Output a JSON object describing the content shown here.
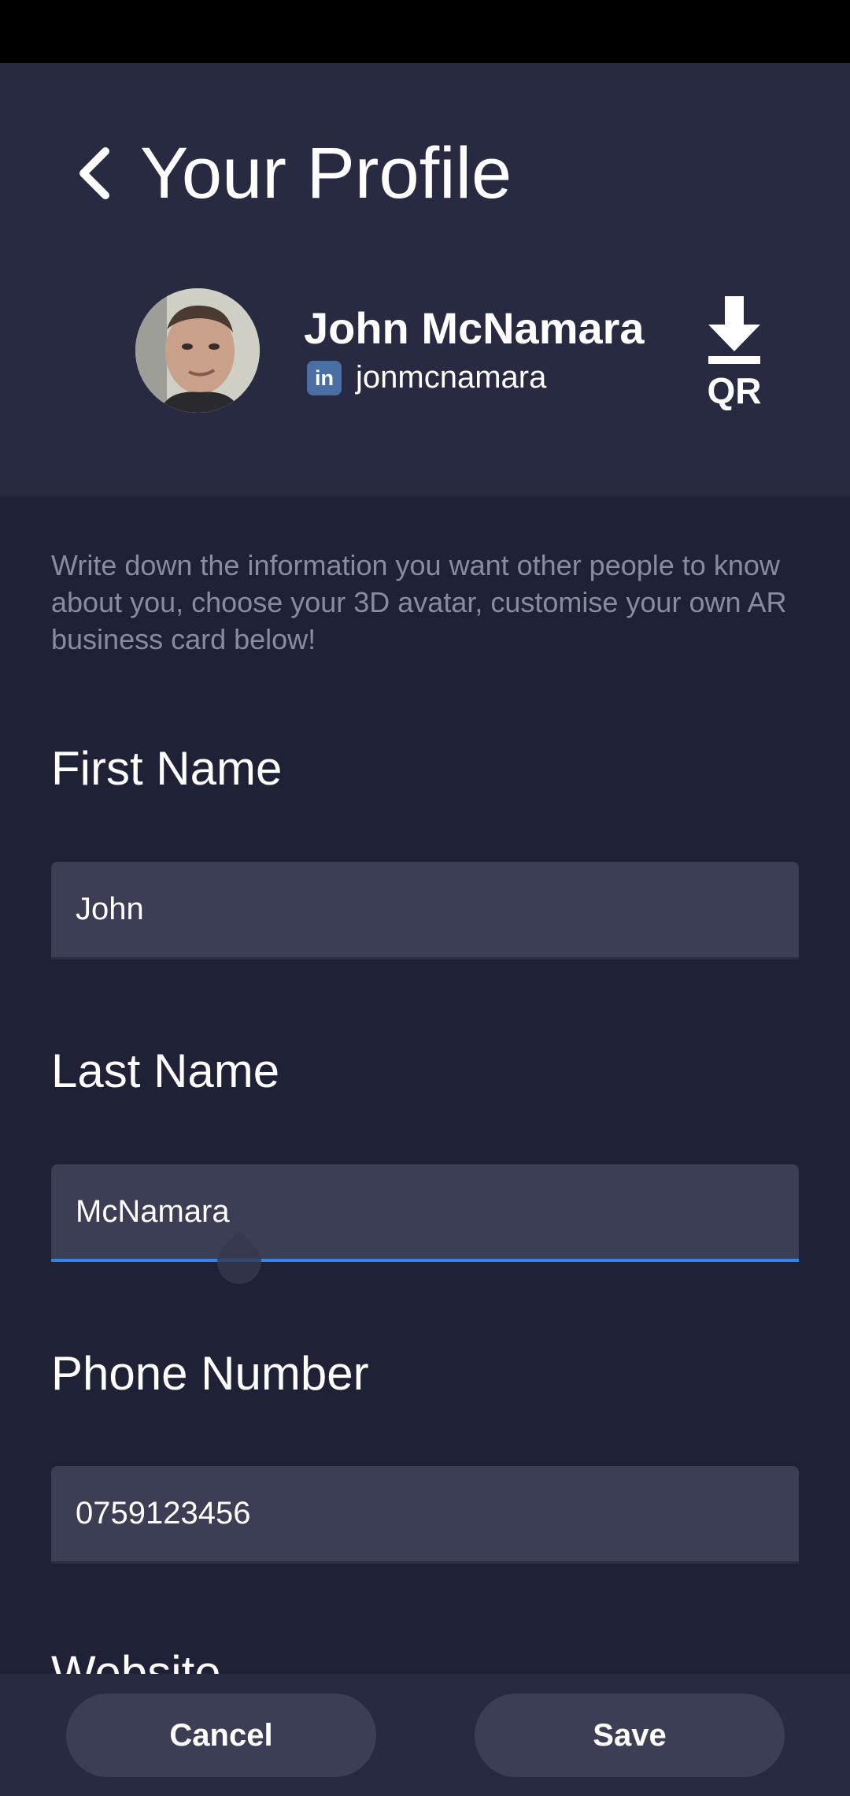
{
  "header": {
    "title": "Your Profile",
    "back_icon": "chevron-left-icon"
  },
  "profile": {
    "name": "John McNamara",
    "social_icon": "linkedin-icon",
    "social_badge": "in",
    "handle": "jonmcnamara",
    "qr_icon": "download-icon",
    "qr_label": "QR"
  },
  "intro_text": "Write down the information you want other people to know about you, choose your 3D avatar, customise your own AR business card below!",
  "fields": {
    "first_name": {
      "label": "First Name",
      "value": "John"
    },
    "last_name": {
      "label": "Last Name",
      "value": "McNamara"
    },
    "phone": {
      "label": "Phone Number",
      "value": "0759123456"
    },
    "website": {
      "label": "Website"
    }
  },
  "footer": {
    "cancel_label": "Cancel",
    "save_label": "Save"
  },
  "colors": {
    "background": "#1f2136",
    "header": "#282a42",
    "input": "#3c3e55",
    "accent": "#2f86e6",
    "muted_text": "#8a8c9e"
  }
}
